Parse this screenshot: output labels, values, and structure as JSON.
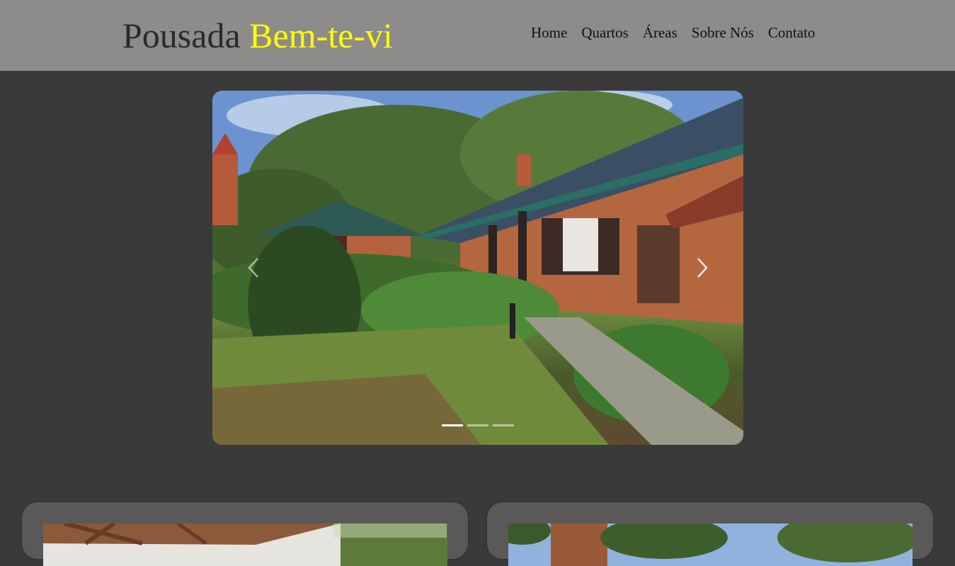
{
  "header": {
    "brand_main": "Pousada ",
    "brand_accent": "Bem-te-vi",
    "brand_accent_color": "#ffff00",
    "nav": [
      {
        "label": "Home"
      },
      {
        "label": "Quartos"
      },
      {
        "label": "Áreas"
      },
      {
        "label": "Sobre Nós"
      },
      {
        "label": "Contato"
      }
    ]
  },
  "carousel": {
    "prev_icon": "chevron-left-icon",
    "next_icon": "chevron-right-icon",
    "slide_count": 3,
    "active_slide": 1
  },
  "colors": {
    "header_bg": "#8e8c8a",
    "page_bg": "#3a3a3a",
    "card_bg": "#5a5858"
  }
}
